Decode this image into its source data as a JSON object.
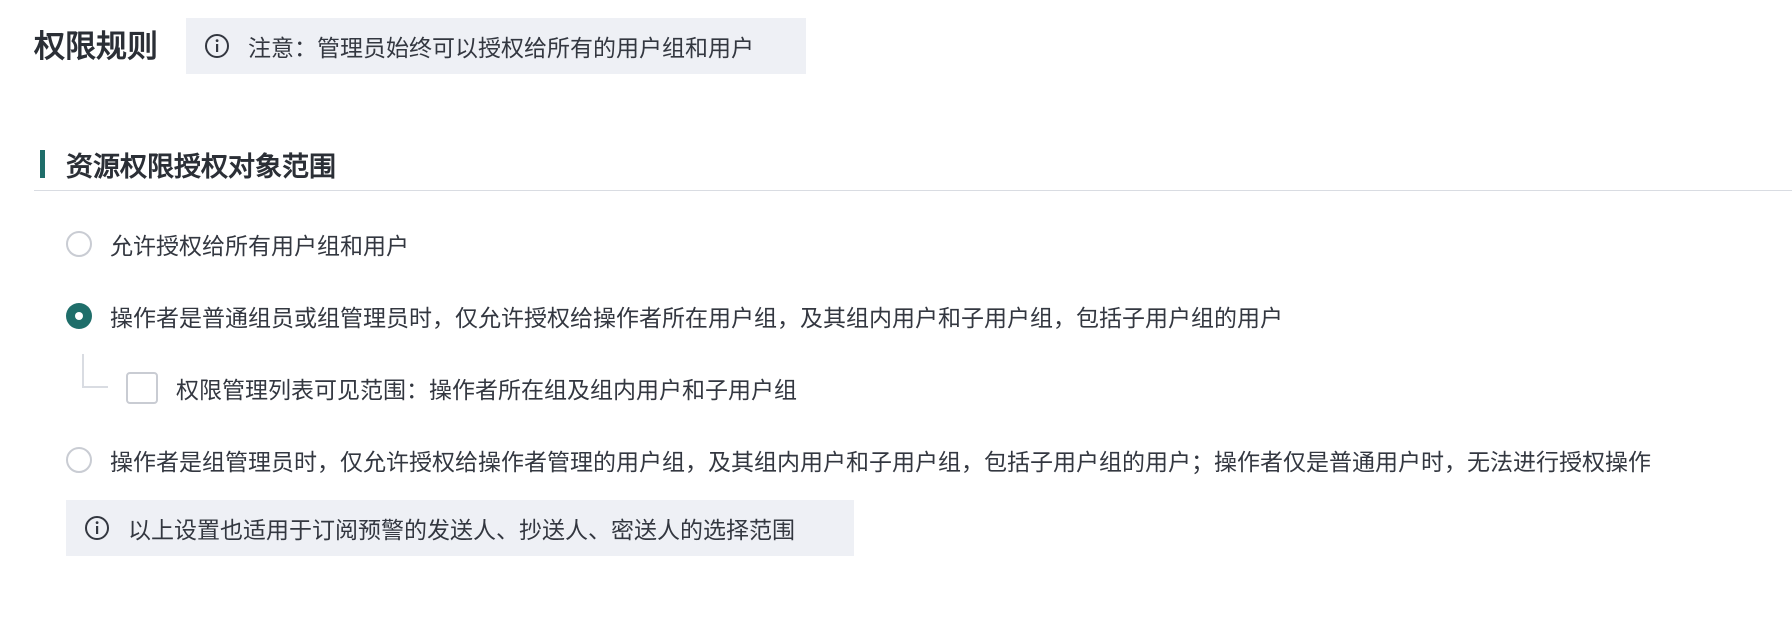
{
  "page": {
    "title": "权限规则"
  },
  "notice": {
    "icon": "info-icon",
    "text": "注意：管理员始终可以授权给所有的用户组和用户"
  },
  "section": {
    "title": "资源权限授权对象范围"
  },
  "options": [
    {
      "label": "允许授权给所有用户组和用户",
      "selected": false
    },
    {
      "label": "操作者是普通组员或组管理员时，仅允许授权给操作者所在用户组，及其组内用户和子用户组，包括子用户组的用户",
      "selected": true
    },
    {
      "label": "操作者是组管理员时，仅允许授权给操作者管理的用户组，及其组内用户和子用户组，包括子用户组的用户；操作者仅是普通用户时，无法进行授权操作",
      "selected": false
    }
  ],
  "sub_option": {
    "label": "权限管理列表可见范围：操作者所在组及组内用户和子用户组",
    "checked": false
  },
  "hint": {
    "icon": "info-icon",
    "text": "以上设置也适用于订阅预警的发送人、抄送人、密送人的选择范围"
  },
  "colors": {
    "accent": "#1f6e6a",
    "notice_bg": "#eef0f5",
    "border": "#c9ccd3"
  }
}
